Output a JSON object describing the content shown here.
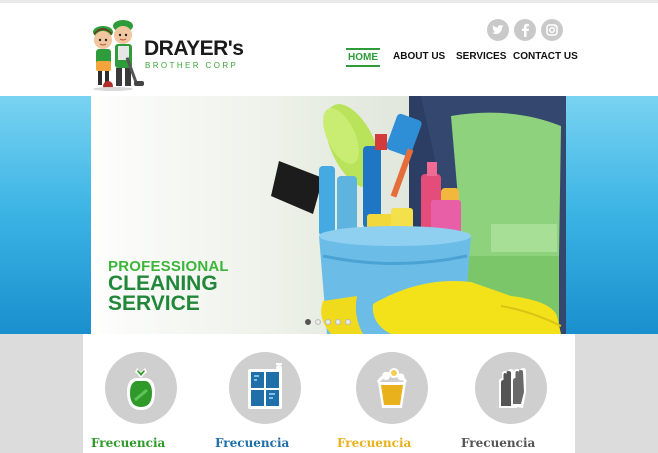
{
  "brand": {
    "name": "DRAYER's",
    "tagline": "BROTHER CORP"
  },
  "social": [
    {
      "icon": "twitter-icon"
    },
    {
      "icon": "facebook-icon"
    },
    {
      "icon": "instagram-icon"
    }
  ],
  "nav": {
    "items": [
      {
        "label": "HOME",
        "active": true
      },
      {
        "label": "ABOUT US",
        "active": false
      },
      {
        "label": "SERVICES",
        "active": false
      },
      {
        "label": "CONTACT US",
        "active": false
      }
    ]
  },
  "hero": {
    "line1": "PROFESSIONAL",
    "line2": "CLEANING",
    "line3": "SERVICE",
    "slide_count": 5,
    "active_slide": 1
  },
  "features": [
    {
      "label": "Frecuencia",
      "icon": "trash-bag-icon",
      "color": "#2f9a2a"
    },
    {
      "label": "Frecuencia",
      "icon": "window-cleaning-icon",
      "color": "#1f6fa8"
    },
    {
      "label": "Frecuencia",
      "icon": "bucket-icon",
      "color": "#e9b21c"
    },
    {
      "label": "Frecuencia",
      "icon": "gloves-icon",
      "color": "#555555"
    }
  ],
  "colors": {
    "accent_green": "#2e9c3a",
    "band_blue": "#3ab3e4",
    "panel_gray": "#dcdcdc"
  }
}
